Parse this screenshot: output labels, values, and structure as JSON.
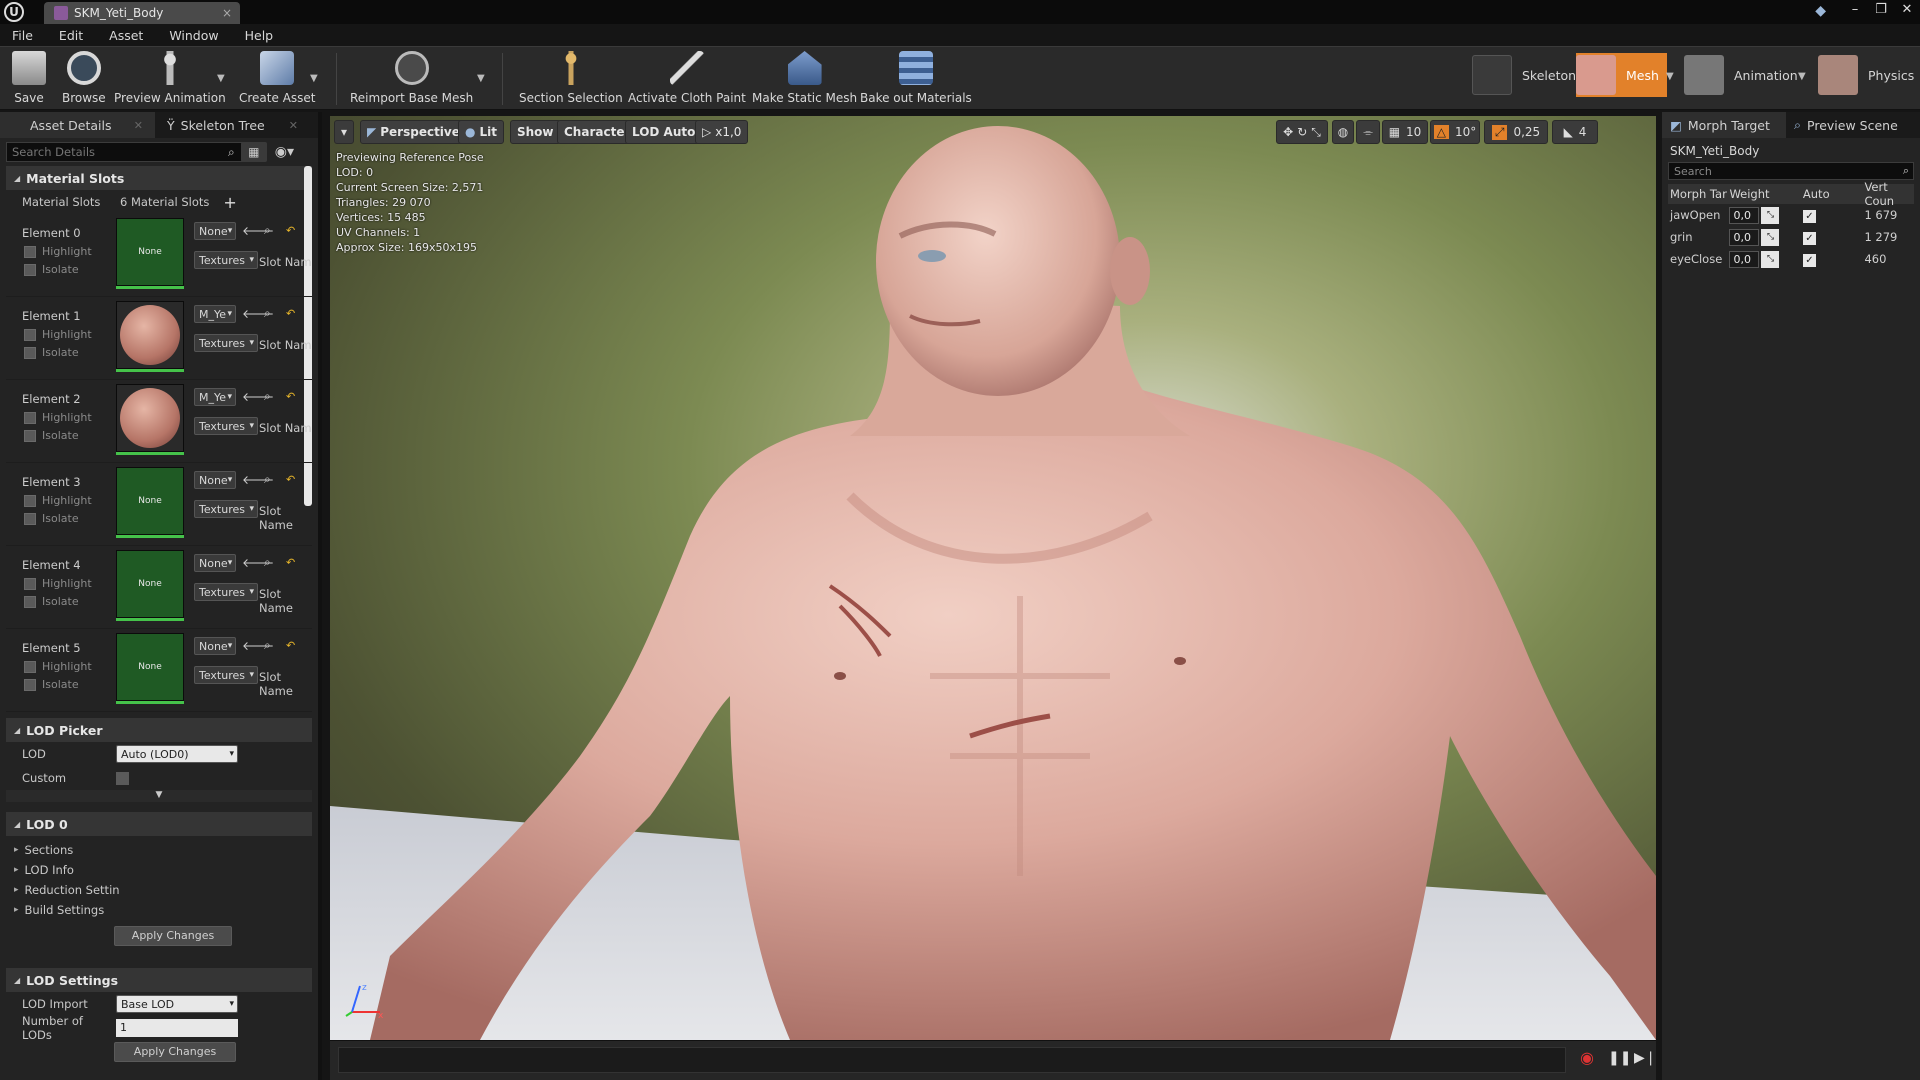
{
  "titlebar": {
    "tab_title": "SKM_Yeti_Body"
  },
  "menu": {
    "items": [
      "File",
      "Edit",
      "Asset",
      "Window",
      "Help"
    ]
  },
  "toolbar": {
    "buttons": [
      {
        "label": "Save",
        "icon": "save-icon"
      },
      {
        "label": "Browse",
        "icon": "browse-icon"
      },
      {
        "label": "Preview Animation",
        "icon": "preview-animation-icon"
      },
      {
        "label": "Create Asset",
        "icon": "create-asset-icon"
      },
      {
        "label": "Reimport Base Mesh",
        "icon": "reimport-icon"
      },
      {
        "label": "Section Selection",
        "icon": "section-selection-icon"
      },
      {
        "label": "Activate Cloth Paint",
        "icon": "cloth-paint-icon"
      },
      {
        "label": "Make Static Mesh",
        "icon": "static-mesh-icon"
      },
      {
        "label": "Bake out Materials",
        "icon": "bake-materials-icon"
      }
    ],
    "modes": [
      {
        "label": "Skeleton",
        "active": false
      },
      {
        "label": "Mesh",
        "active": true
      },
      {
        "label": "Animation",
        "active": false
      },
      {
        "label": "Physics",
        "active": false
      }
    ],
    "accent_color": "#e2812a"
  },
  "left_panel": {
    "tabs": [
      "Asset Details",
      "Skeleton Tree"
    ],
    "search_placeholder": "Search Details",
    "material_slots": {
      "header": "Material Slots",
      "label": "Material Slots",
      "count": "6 Material Slots",
      "elements": [
        {
          "name": "Element 0",
          "material": "None",
          "dropdown": "None",
          "slot_name": "Slot Nam",
          "thumb": "None"
        },
        {
          "name": "Element 1",
          "material": "M_Ye",
          "dropdown": "M_Ye",
          "slot_name": "Slot Nam",
          "thumb": ""
        },
        {
          "name": "Element 2",
          "material": "M_Ye",
          "dropdown": "M_Ye",
          "slot_name": "Slot Nam",
          "thumb": ""
        },
        {
          "name": "Element 3",
          "material": "None",
          "dropdown": "None",
          "slot_name": "Slot Name",
          "thumb": "None"
        },
        {
          "name": "Element 4",
          "material": "None",
          "dropdown": "None",
          "slot_name": "Slot Name",
          "thumb": "None"
        },
        {
          "name": "Element 5",
          "material": "None",
          "dropdown": "None",
          "slot_name": "Slot Name",
          "thumb": "None"
        }
      ],
      "highlight_label": "Highlight",
      "isolate_label": "Isolate",
      "textures_label": "Textures"
    },
    "lod_picker": {
      "header": "LOD Picker",
      "lod_label": "LOD",
      "lod_value": "Auto (LOD0)",
      "custom_label": "Custom"
    },
    "lod0": {
      "header": "LOD 0",
      "items": [
        "Sections",
        "LOD Info",
        "Reduction Settin",
        "Build Settings"
      ],
      "apply": "Apply Changes"
    },
    "lod_settings": {
      "header": "LOD Settings",
      "import_label": "LOD Import",
      "import_value": "Base LOD",
      "num_label": "Number of LODs",
      "num_value": "1",
      "apply": "Apply Changes"
    }
  },
  "viewport": {
    "toolbar": {
      "perspective": "Perspective",
      "lit": "Lit",
      "show": "Show",
      "character": "Character",
      "lod": "LOD Auto",
      "speed": "x1,0",
      "grid_snap": "10",
      "rot_snap": "10°",
      "scale_snap": "0,25",
      "cam_speed": "4"
    },
    "info_lines": [
      "Previewing Reference Pose",
      "LOD: 0",
      "Current Screen Size: 2,571",
      "Triangles: 29 070",
      "Vertices: 15 485",
      "UV Channels: 1",
      "Approx Size: 169x50x195"
    ],
    "axis": {
      "z": "z",
      "x": "x"
    }
  },
  "right_panel": {
    "tabs": [
      "Morph Target",
      "Preview Scene"
    ],
    "mesh_name": "SKM_Yeti_Body",
    "search_placeholder": "Search",
    "columns": [
      "Morph Tar",
      "Weight",
      "Auto",
      "Vert Coun"
    ],
    "rows": [
      {
        "name": "jawOpen",
        "weight": "0,0",
        "auto": true,
        "verts": "1 679"
      },
      {
        "name": "grin",
        "weight": "0,0",
        "auto": true,
        "verts": "1 279"
      },
      {
        "name": "eyeClose",
        "weight": "0,0",
        "auto": true,
        "verts": "460"
      }
    ]
  }
}
